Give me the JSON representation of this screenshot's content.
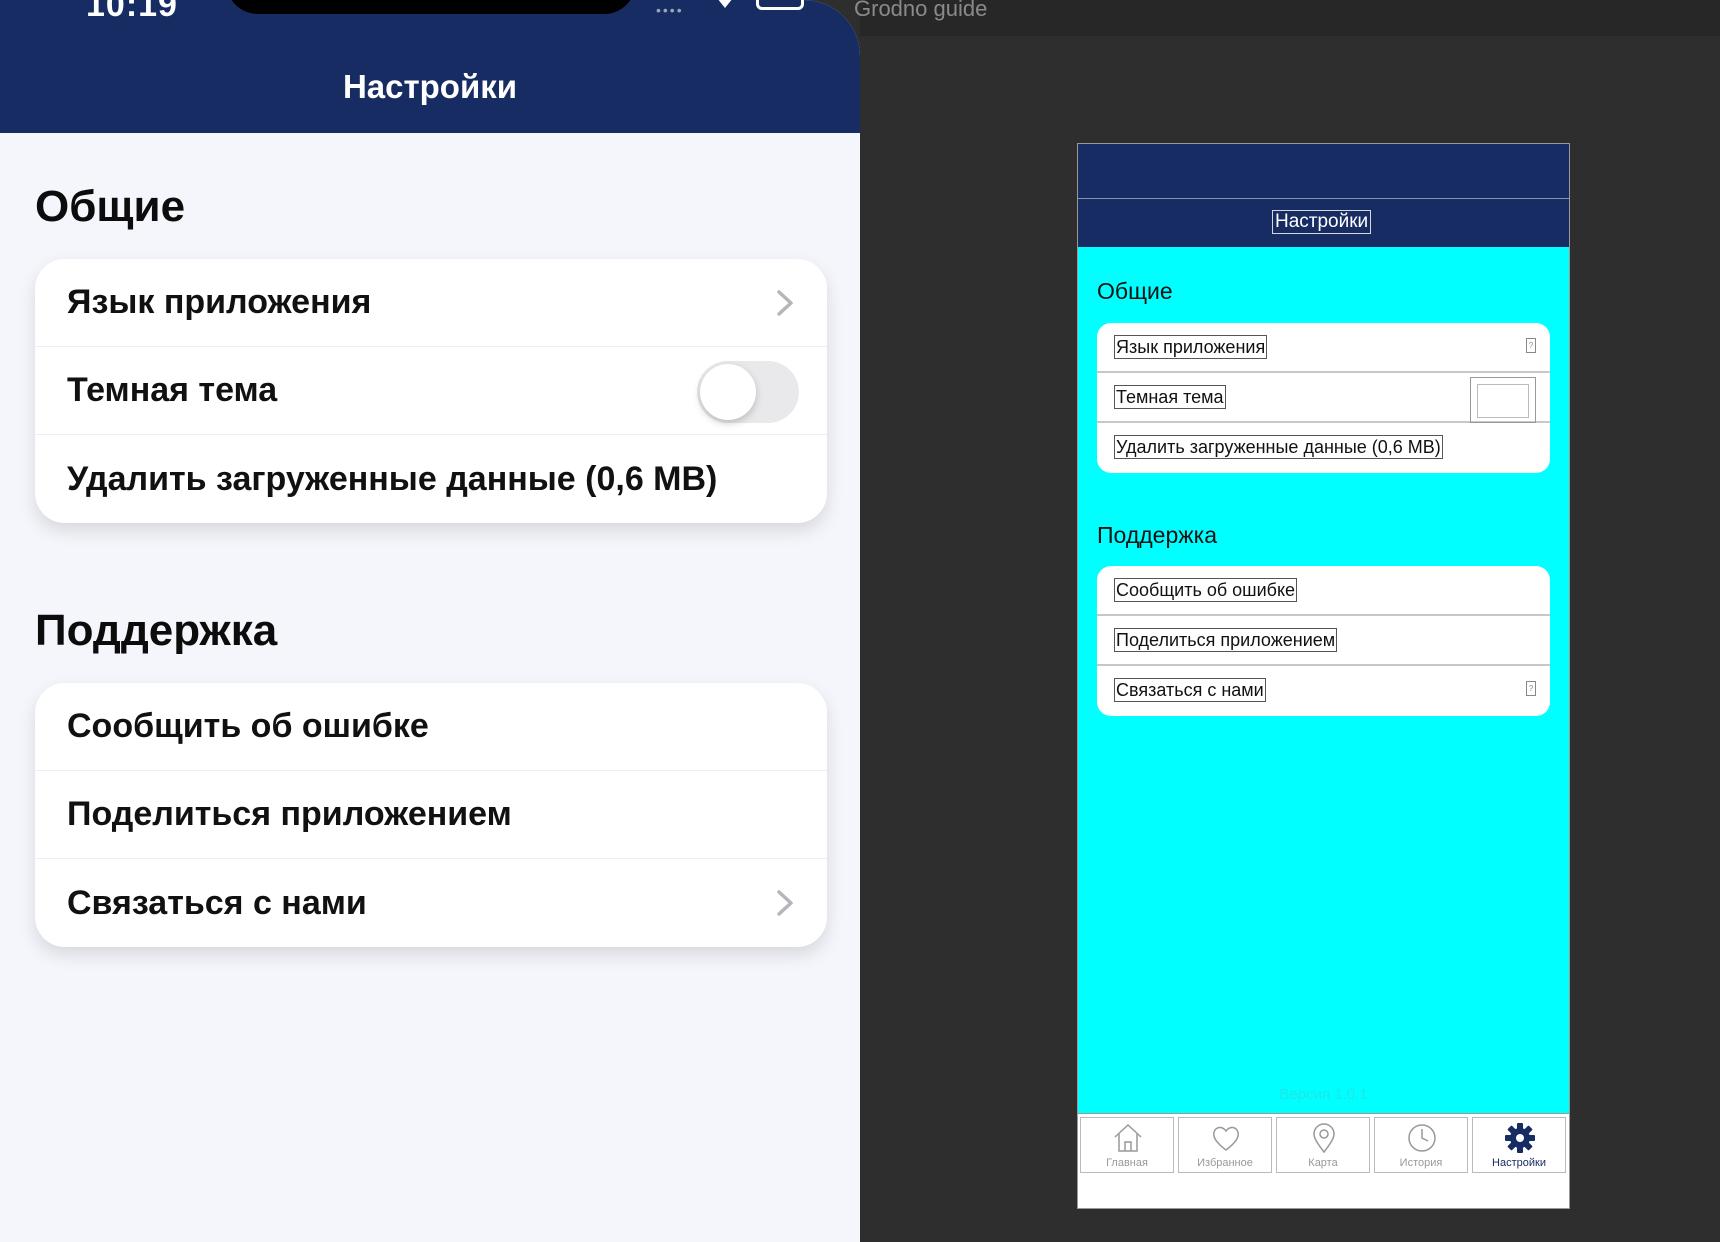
{
  "status_bar": {
    "time": "10:19",
    "dots": "••••"
  },
  "phone": {
    "title": "Настройки",
    "sections": [
      {
        "title": "Общие",
        "items": [
          {
            "label": "Язык приложения",
            "accessory": "chevron-right"
          },
          {
            "label": "Темная тема",
            "accessory": "toggle",
            "toggle_on": false
          },
          {
            "label": "Удалить загруженные данные (0,6 MB)",
            "accessory": "none"
          }
        ]
      },
      {
        "title": "Поддержка",
        "items": [
          {
            "label": "Сообщить об ошибке",
            "accessory": "none"
          },
          {
            "label": "Поделиться приложением",
            "accessory": "none"
          },
          {
            "label": "Связаться с нами",
            "accessory": "chevron-right"
          }
        ]
      }
    ]
  },
  "editor": {
    "window_title": "Grodno guide",
    "preview": {
      "title": "Настройки",
      "sections": [
        {
          "title": "Общие",
          "items": [
            {
              "label": "Язык приложения",
              "accessory": "glyph"
            },
            {
              "label": "Темная тема",
              "accessory": "switch"
            },
            {
              "label": "Удалить загруженные данные (0,6 MB)",
              "accessory": "none"
            }
          ]
        },
        {
          "title": "Поддержка",
          "items": [
            {
              "label": "Сообщить об ошибке",
              "accessory": "none"
            },
            {
              "label": "Поделиться приложением",
              "accessory": "none"
            },
            {
              "label": "Связаться с нами",
              "accessory": "glyph"
            }
          ]
        }
      ],
      "version": "Версия 1.0.1",
      "tabs": [
        {
          "label": "Главная",
          "icon": "home-icon",
          "active": false
        },
        {
          "label": "Избранное",
          "icon": "heart-icon",
          "active": false
        },
        {
          "label": "Карта",
          "icon": "map-pin-icon",
          "active": false
        },
        {
          "label": "История",
          "icon": "clock-icon",
          "active": false
        },
        {
          "label": "Настройки",
          "icon": "gear-icon",
          "active": true
        }
      ]
    }
  },
  "colors": {
    "header": "#162c63",
    "preview_bg": "#00ffff",
    "app_bg": "#f5f6fb",
    "toggle_off": "#e9e9eb"
  }
}
